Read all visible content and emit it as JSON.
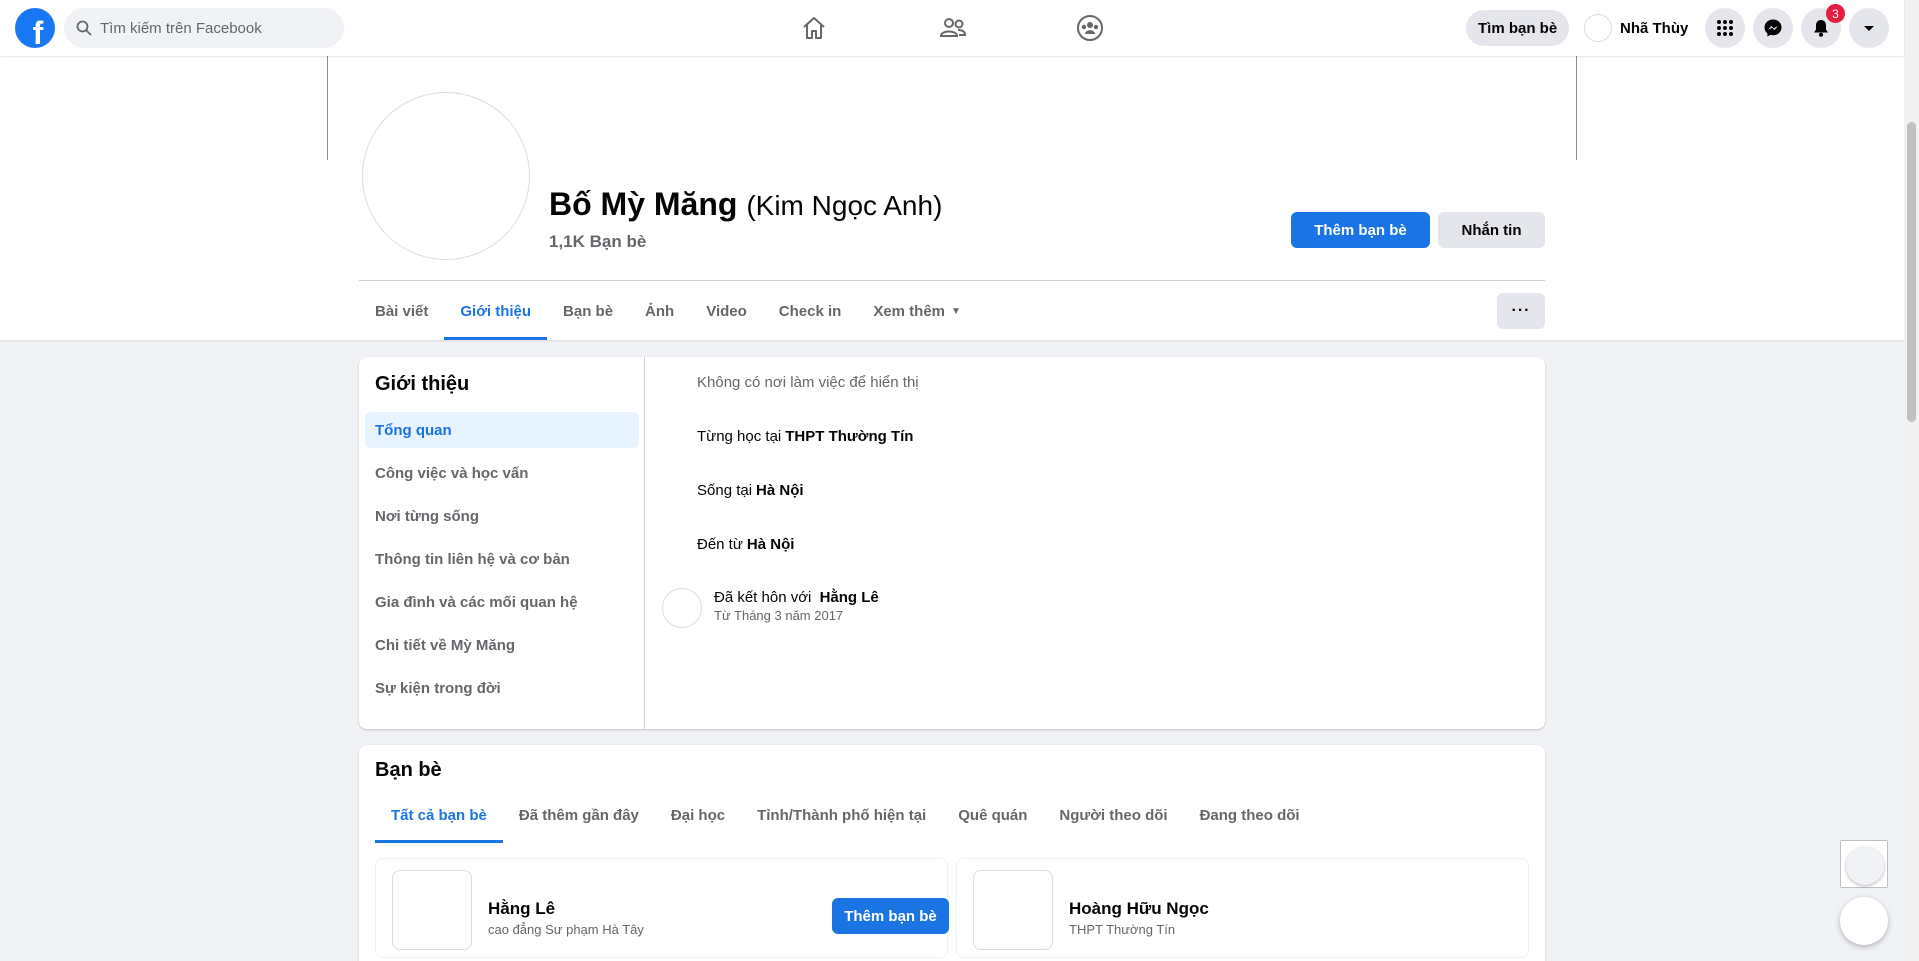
{
  "topbar": {
    "logo_letter": "f",
    "search_placeholder": "Tìm kiếm trên Facebook",
    "find_friends": "Tìm bạn bè",
    "user_name": "Nhã Thùy",
    "notification_count": "3"
  },
  "profile": {
    "name": "Bố Mỳ Măng",
    "alt_name": "(Kim Ngọc Anh)",
    "friend_count": "1,1K Bạn bè",
    "add_friend": "Thêm bạn bè",
    "message": "Nhắn tin",
    "more_dots": "···"
  },
  "tabs": [
    "Bài viết",
    "Giới thiệu",
    "Bạn bè",
    "Ảnh",
    "Video",
    "Check in",
    "Xem thêm"
  ],
  "about": {
    "title": "Giới thiệu",
    "nav": [
      "Tổng quan",
      "Công việc và học vấn",
      "Nơi từng sống",
      "Thông tin liên hệ và cơ bản",
      "Gia đình và các mối quan hệ",
      "Chi tiết về Mỳ Măng",
      "Sự kiện trong đời"
    ],
    "no_work": "Không có nơi làm việc để hiển thị",
    "studied_prefix": "Từng học tại",
    "studied_at": "THPT Thường Tín",
    "lives_prefix": "Sống tại",
    "lives_in": "Hà Nội",
    "from_prefix": "Đến từ",
    "from_place": "Hà Nội",
    "married_prefix": "Đã kết hôn với",
    "married_to": "Hằng Lê",
    "married_since": "Từ Tháng 3 năm 2017"
  },
  "friends": {
    "title": "Bạn bè",
    "tabs": [
      "Tất cả bạn bè",
      "Đã thêm gần đây",
      "Đại học",
      "Tỉnh/Thành phố hiện tại",
      "Quê quán",
      "Người theo dõi",
      "Đang theo dõi"
    ],
    "list": [
      {
        "name": "Hằng Lê",
        "sub": "cao đẳng Sư phạm Hà Tây",
        "button": "Thêm bạn bè"
      },
      {
        "name": "Hoàng Hữu Ngọc",
        "sub": "THPT Thường Tín"
      }
    ]
  },
  "colors": {
    "accent": "#1b74e4",
    "background": "#f0f2f5",
    "badge": "#e41e3f"
  },
  "icons": [
    "search-icon",
    "home-icon",
    "friends-icon",
    "groups-icon",
    "menu-grid-icon",
    "messenger-icon",
    "bell-icon",
    "account-caret-icon"
  ]
}
